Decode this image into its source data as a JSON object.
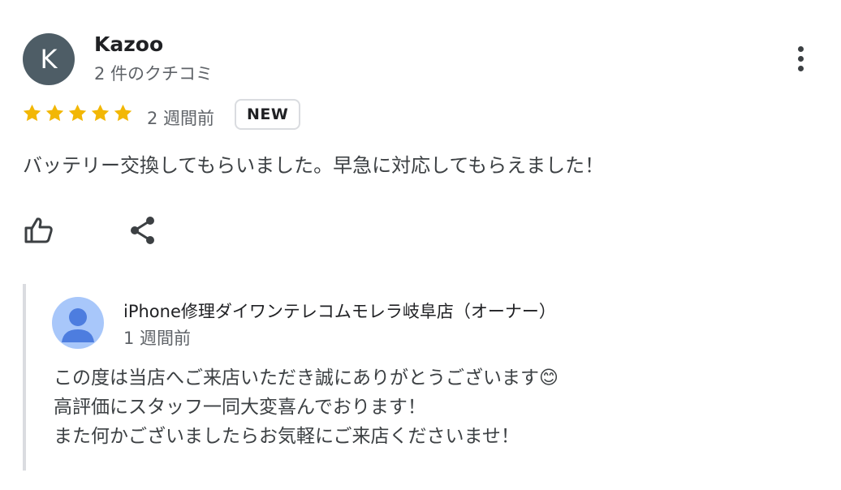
{
  "reviewer": {
    "initial": "K",
    "name": "Kazoo",
    "review_count": "2 件のクチコミ",
    "avatar_color": "#4e5d66"
  },
  "rating": {
    "stars": 5,
    "max": 5,
    "star_color": "#f2b705"
  },
  "time_ago": "2 週間前",
  "badge": "NEW",
  "review_text": "バッテリー交換してもらいました。早急に対応してもらえました！",
  "actions": {
    "like_icon": "thumb-up-icon",
    "share_icon": "share-icon",
    "more_icon": "more-vert-icon"
  },
  "owner_reply": {
    "name": "iPhone修理ダイワンテレコムモレラ岐阜店（オーナー）",
    "time_ago": "1 週間前",
    "avatar_color": "#a8c7fa",
    "lines": [
      "この度は当店へご来店いただき誠にありがとうございます😊",
      "高評価にスタッフ一同大変喜んでおります！",
      "また何かございましたらお気軽にご来店くださいませ！"
    ]
  }
}
